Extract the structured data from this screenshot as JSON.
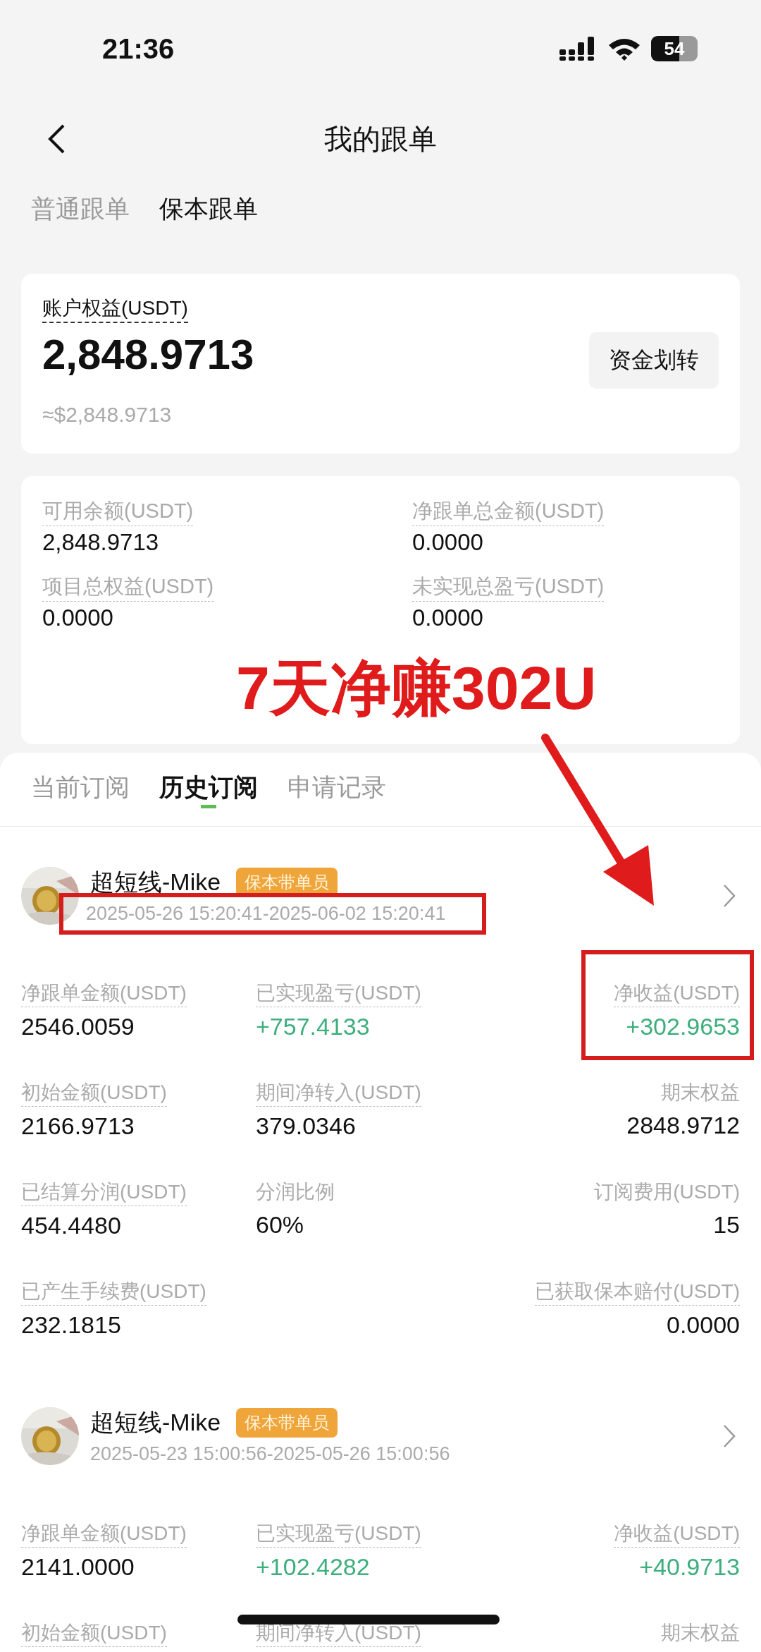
{
  "status_bar": {
    "time": "21:36",
    "battery": "54"
  },
  "nav": {
    "title": "我的跟单"
  },
  "mode_tabs": [
    {
      "label": "普通跟单",
      "selected": false
    },
    {
      "label": "保本跟单",
      "selected": true
    }
  ],
  "equity": {
    "label": "账户权益(USDT)",
    "value": "2,848.9713",
    "approx": "≈$2,848.9713",
    "button": "资金划转"
  },
  "summary": [
    {
      "label": "可用余额(USDT)",
      "value": "2,848.9713"
    },
    {
      "label": "净跟单总金额(USDT)",
      "value": "0.0000"
    },
    {
      "label": "项目总权益(USDT)",
      "value": "0.0000"
    },
    {
      "label": "未实现总盈亏(USDT)",
      "value": "0.0000"
    }
  ],
  "annotation": {
    "text": "7天净赚302U"
  },
  "sub_tabs": [
    {
      "label": "当前订阅",
      "selected": false
    },
    {
      "label": "历史订阅",
      "selected": true
    },
    {
      "label": "申请记录",
      "selected": false
    }
  ],
  "subscriptions": [
    {
      "name": "超短线-Mike",
      "badge": "保本带单员",
      "period": "2025-05-26 15:20:41-2025-06-02 15:20:41",
      "period_marked": true,
      "rows": [
        [
          {
            "label": "净跟单金额(USDT)",
            "value": "2546.0059",
            "gain": false,
            "underlined": true,
            "marked": false
          },
          {
            "label": "已实现盈亏(USDT)",
            "value": "+757.4133",
            "gain": true,
            "underlined": true,
            "marked": false
          },
          {
            "label": "净收益(USDT)",
            "value": "+302.9653",
            "gain": true,
            "underlined": true,
            "marked": true
          }
        ],
        [
          {
            "label": "初始金额(USDT)",
            "value": "2166.9713",
            "gain": false,
            "underlined": true,
            "marked": false
          },
          {
            "label": "期间净转入(USDT)",
            "value": "379.0346",
            "gain": false,
            "underlined": true,
            "marked": false
          },
          {
            "label": "期末权益",
            "value": "2848.9712",
            "gain": false,
            "underlined": false,
            "marked": false
          }
        ],
        [
          {
            "label": "已结算分润(USDT)",
            "value": "454.4480",
            "gain": false,
            "underlined": true,
            "marked": false
          },
          {
            "label": "分润比例",
            "value": "60%",
            "gain": false,
            "underlined": false,
            "marked": false
          },
          {
            "label": "订阅费用(USDT)",
            "value": "15",
            "gain": false,
            "underlined": false,
            "marked": false
          }
        ],
        [
          {
            "label": "已产生手续费(USDT)",
            "value": "232.1815",
            "gain": false,
            "underlined": true,
            "marked": false
          },
          "",
          {
            "label": "已获取保本赔付(USDT)",
            "value": "0.0000",
            "gain": false,
            "underlined": true,
            "marked": false
          }
        ]
      ]
    },
    {
      "name": "超短线-Mike",
      "badge": "保本带单员",
      "period": "2025-05-23 15:00:56-2025-05-26 15:00:56",
      "period_marked": false,
      "rows": [
        [
          {
            "label": "净跟单金额(USDT)",
            "value": "2141.0000",
            "gain": false,
            "underlined": true,
            "marked": false
          },
          {
            "label": "已实现盈亏(USDT)",
            "value": "+102.4282",
            "gain": true,
            "underlined": true,
            "marked": false
          },
          {
            "label": "净收益(USDT)",
            "value": "+40.9713",
            "gain": true,
            "underlined": true,
            "marked": false
          }
        ],
        [
          {
            "label": "初始金额(USDT)",
            "underlined": true,
            "marked": false
          },
          {
            "label": "期间净转入(USDT)",
            "underlined": true,
            "marked": false
          },
          {
            "label": "期末权益",
            "underlined": false,
            "marked": false
          }
        ]
      ]
    }
  ]
}
